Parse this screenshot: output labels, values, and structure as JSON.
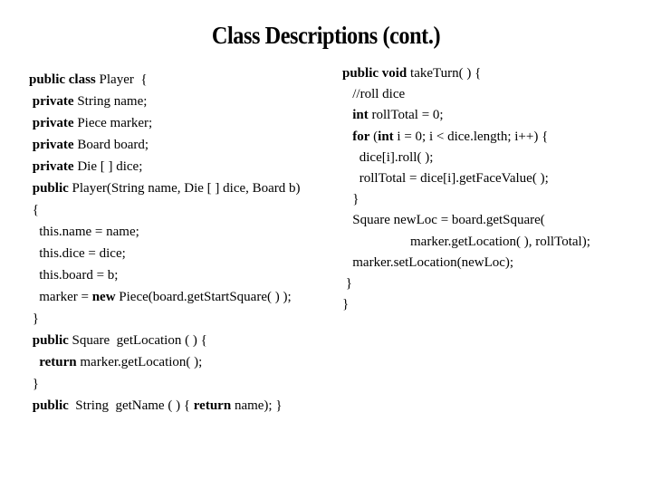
{
  "title": "Class Descriptions (cont.)",
  "left_code": [
    [
      {
        "t": "public class",
        "b": true
      },
      {
        "t": " Player  {"
      }
    ],
    [
      {
        "t": " "
      },
      {
        "t": "private",
        "b": true
      },
      {
        "t": " String name;"
      }
    ],
    [
      {
        "t": " "
      },
      {
        "t": "private",
        "b": true
      },
      {
        "t": " Piece marker;"
      }
    ],
    [
      {
        "t": " "
      },
      {
        "t": "private",
        "b": true
      },
      {
        "t": " Board board;"
      }
    ],
    [
      {
        "t": " "
      },
      {
        "t": "private",
        "b": true
      },
      {
        "t": " Die [ ] dice;"
      }
    ],
    [
      {
        "t": " "
      },
      {
        "t": "public",
        "b": true
      },
      {
        "t": " Player(String name, Die [ ] dice, Board b)"
      }
    ],
    [
      {
        "t": " {"
      }
    ],
    [
      {
        "t": "   this.name = name;"
      }
    ],
    [
      {
        "t": "   this.dice = dice;"
      }
    ],
    [
      {
        "t": "   this.board = b;"
      }
    ],
    [
      {
        "t": "   marker = "
      },
      {
        "t": "new",
        "b": true
      },
      {
        "t": " Piece(board.getStartSquare( ) );"
      }
    ],
    [
      {
        "t": " }"
      }
    ],
    [
      {
        "t": " "
      },
      {
        "t": "public",
        "b": true
      },
      {
        "t": " Square  getLocation ( ) {"
      }
    ],
    [
      {
        "t": "   "
      },
      {
        "t": "return",
        "b": true
      },
      {
        "t": " marker.getLocation( );"
      }
    ],
    [
      {
        "t": " }"
      }
    ],
    [
      {
        "t": " "
      },
      {
        "t": "public",
        "b": true
      },
      {
        "t": "  String  getName ( ) { "
      },
      {
        "t": "return",
        "b": true
      },
      {
        "t": " name); }"
      }
    ]
  ],
  "right_code": [
    [
      {
        "t": "public void",
        "b": true
      },
      {
        "t": " takeTurn( ) {"
      }
    ],
    [
      {
        "t": "   //roll dice"
      }
    ],
    [
      {
        "t": "   "
      },
      {
        "t": "int",
        "b": true
      },
      {
        "t": " rollTotal = 0;"
      }
    ],
    [
      {
        "t": "   "
      },
      {
        "t": "for",
        "b": true
      },
      {
        "t": " ("
      },
      {
        "t": "int",
        "b": true
      },
      {
        "t": " i = 0; i < dice.length; i++) {"
      }
    ],
    [
      {
        "t": "     dice[i].roll( );"
      }
    ],
    [
      {
        "t": "     rollTotal = dice[i].getFaceValue( );"
      }
    ],
    [
      {
        "t": "   }"
      }
    ],
    [
      {
        "t": "   Square newLoc = board.getSquare("
      }
    ],
    [
      {
        "t": "                    marker.getLocation( ), rollTotal);"
      }
    ],
    [
      {
        "t": "   marker.setLocation(newLoc);"
      }
    ],
    [
      {
        "t": " }"
      }
    ],
    [
      {
        "t": "}"
      }
    ]
  ]
}
